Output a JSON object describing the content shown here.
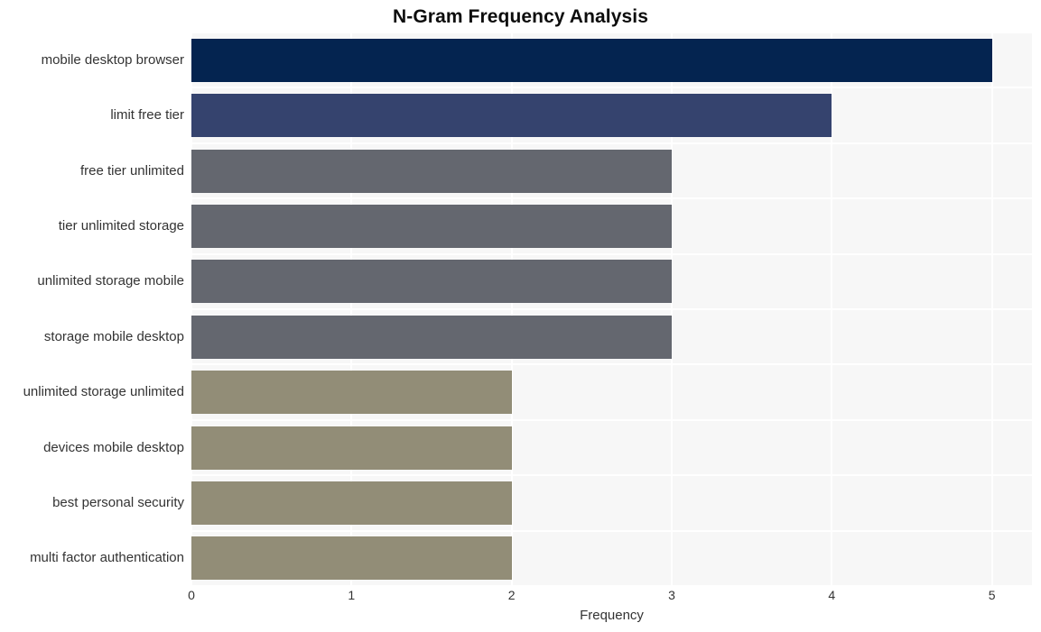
{
  "chart_data": {
    "type": "bar",
    "orientation": "horizontal",
    "title": "N-Gram Frequency Analysis",
    "xlabel": "Frequency",
    "ylabel": "",
    "xlim": [
      0,
      5.25
    ],
    "xticks": [
      "0",
      "1",
      "2",
      "3",
      "4",
      "5"
    ],
    "xtick_values": [
      0,
      1,
      2,
      3,
      4,
      5
    ],
    "grid": true,
    "legend": "none",
    "categories": [
      "mobile desktop browser",
      "limit free tier",
      "free tier unlimited",
      "tier unlimited storage",
      "unlimited storage mobile",
      "storage mobile desktop",
      "unlimited storage unlimited",
      "devices mobile desktop",
      "best personal security",
      "multi factor authentication"
    ],
    "values": [
      5,
      4,
      3,
      3,
      3,
      3,
      2,
      2,
      2,
      2
    ],
    "bar_colors": [
      "#042450",
      "#35436e",
      "#64676f",
      "#64676f",
      "#64676f",
      "#64676f",
      "#928d77",
      "#928d77",
      "#928d77",
      "#928d77"
    ]
  },
  "style": {
    "plot_background": "#f7f7f7",
    "gridline_color": "#ffffff",
    "page_background": "#ffffff",
    "text_color": "#333333",
    "title_color": "#0d0d0d"
  }
}
